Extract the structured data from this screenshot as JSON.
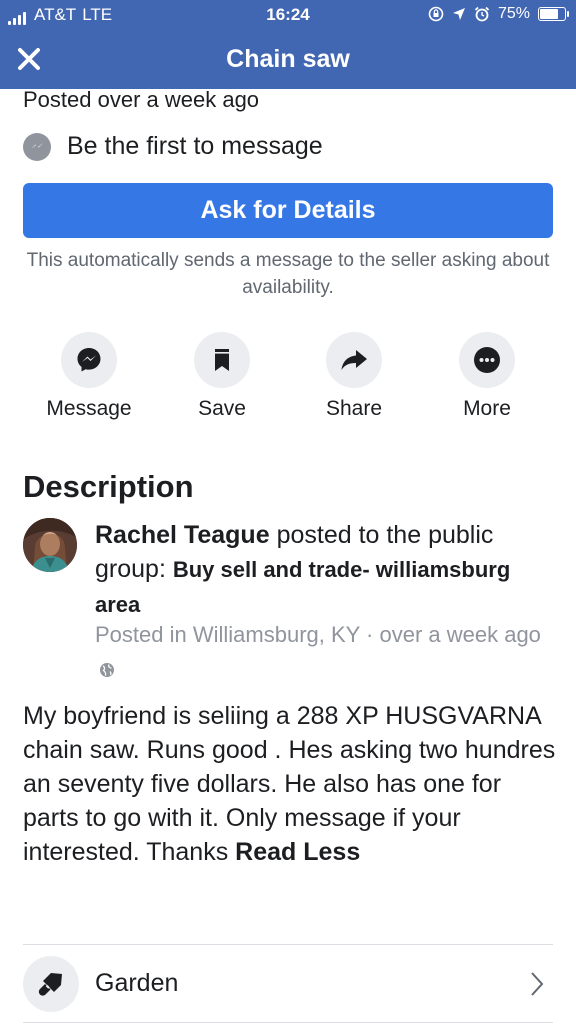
{
  "status_bar": {
    "carrier": "AT&T",
    "network": "LTE",
    "time": "16:24",
    "battery_percent": "75%",
    "battery_level": 0.75,
    "icons": [
      "signal-icon",
      "orientation-lock-icon",
      "location-icon",
      "alarm-icon",
      "battery-icon"
    ]
  },
  "nav": {
    "title": "Chain saw",
    "close_icon": "close-icon"
  },
  "listing": {
    "posted": "Posted over a week ago",
    "first_message": "Be the first to message",
    "ask_button": "Ask for Details",
    "ask_note": "This automatically sends a message to the seller asking about availability."
  },
  "actions": [
    {
      "label": "Message",
      "icon": "messenger-icon"
    },
    {
      "label": "Save",
      "icon": "bookmark-icon"
    },
    {
      "label": "Share",
      "icon": "share-arrow-icon"
    },
    {
      "label": "More",
      "icon": "more-dots-icon"
    }
  ],
  "description": {
    "heading": "Description",
    "author": "Rachel Teague",
    "posted_to": "posted to the public group:",
    "group": "Buy sell and trade- williamsburg area",
    "location": "Posted in Williamsburg, KY · over a week ago",
    "body": "My boyfriend is seliing a 288 XP HUSGVARNA  chain saw. Runs good . Hes asking two hundres an seventy five dollars. He also has one for parts to go with it. Only message if your interested. Thanks ",
    "read_less": "Read Less"
  },
  "category": {
    "label": "Garden",
    "icon": "trowel-icon"
  },
  "colors": {
    "header_blue": "#4267b2",
    "button_blue": "#3578e5",
    "secondary_text": "#90949c",
    "icon_bg": "#ebedf0"
  }
}
